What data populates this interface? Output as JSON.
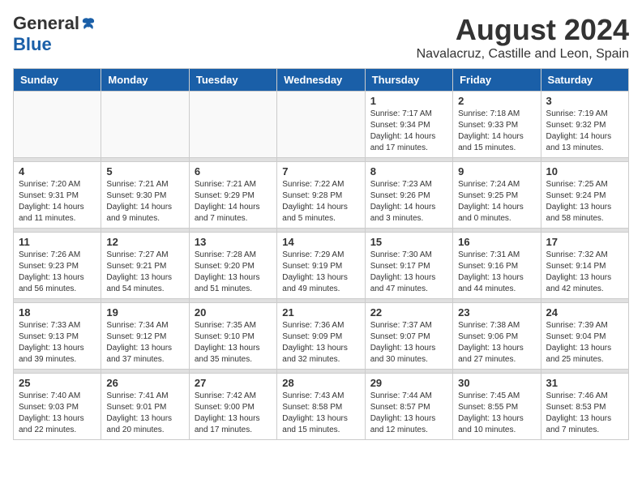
{
  "logo": {
    "general": "General",
    "blue": "Blue"
  },
  "title": "August 2024",
  "location": "Navalacruz, Castille and Leon, Spain",
  "days_header": [
    "Sunday",
    "Monday",
    "Tuesday",
    "Wednesday",
    "Thursday",
    "Friday",
    "Saturday"
  ],
  "weeks": [
    [
      {
        "day": "",
        "info": ""
      },
      {
        "day": "",
        "info": ""
      },
      {
        "day": "",
        "info": ""
      },
      {
        "day": "",
        "info": ""
      },
      {
        "day": "1",
        "info": "Sunrise: 7:17 AM\nSunset: 9:34 PM\nDaylight: 14 hours\nand 17 minutes."
      },
      {
        "day": "2",
        "info": "Sunrise: 7:18 AM\nSunset: 9:33 PM\nDaylight: 14 hours\nand 15 minutes."
      },
      {
        "day": "3",
        "info": "Sunrise: 7:19 AM\nSunset: 9:32 PM\nDaylight: 14 hours\nand 13 minutes."
      }
    ],
    [
      {
        "day": "4",
        "info": "Sunrise: 7:20 AM\nSunset: 9:31 PM\nDaylight: 14 hours\nand 11 minutes."
      },
      {
        "day": "5",
        "info": "Sunrise: 7:21 AM\nSunset: 9:30 PM\nDaylight: 14 hours\nand 9 minutes."
      },
      {
        "day": "6",
        "info": "Sunrise: 7:21 AM\nSunset: 9:29 PM\nDaylight: 14 hours\nand 7 minutes."
      },
      {
        "day": "7",
        "info": "Sunrise: 7:22 AM\nSunset: 9:28 PM\nDaylight: 14 hours\nand 5 minutes."
      },
      {
        "day": "8",
        "info": "Sunrise: 7:23 AM\nSunset: 9:26 PM\nDaylight: 14 hours\nand 3 minutes."
      },
      {
        "day": "9",
        "info": "Sunrise: 7:24 AM\nSunset: 9:25 PM\nDaylight: 14 hours\nand 0 minutes."
      },
      {
        "day": "10",
        "info": "Sunrise: 7:25 AM\nSunset: 9:24 PM\nDaylight: 13 hours\nand 58 minutes."
      }
    ],
    [
      {
        "day": "11",
        "info": "Sunrise: 7:26 AM\nSunset: 9:23 PM\nDaylight: 13 hours\nand 56 minutes."
      },
      {
        "day": "12",
        "info": "Sunrise: 7:27 AM\nSunset: 9:21 PM\nDaylight: 13 hours\nand 54 minutes."
      },
      {
        "day": "13",
        "info": "Sunrise: 7:28 AM\nSunset: 9:20 PM\nDaylight: 13 hours\nand 51 minutes."
      },
      {
        "day": "14",
        "info": "Sunrise: 7:29 AM\nSunset: 9:19 PM\nDaylight: 13 hours\nand 49 minutes."
      },
      {
        "day": "15",
        "info": "Sunrise: 7:30 AM\nSunset: 9:17 PM\nDaylight: 13 hours\nand 47 minutes."
      },
      {
        "day": "16",
        "info": "Sunrise: 7:31 AM\nSunset: 9:16 PM\nDaylight: 13 hours\nand 44 minutes."
      },
      {
        "day": "17",
        "info": "Sunrise: 7:32 AM\nSunset: 9:14 PM\nDaylight: 13 hours\nand 42 minutes."
      }
    ],
    [
      {
        "day": "18",
        "info": "Sunrise: 7:33 AM\nSunset: 9:13 PM\nDaylight: 13 hours\nand 39 minutes."
      },
      {
        "day": "19",
        "info": "Sunrise: 7:34 AM\nSunset: 9:12 PM\nDaylight: 13 hours\nand 37 minutes."
      },
      {
        "day": "20",
        "info": "Sunrise: 7:35 AM\nSunset: 9:10 PM\nDaylight: 13 hours\nand 35 minutes."
      },
      {
        "day": "21",
        "info": "Sunrise: 7:36 AM\nSunset: 9:09 PM\nDaylight: 13 hours\nand 32 minutes."
      },
      {
        "day": "22",
        "info": "Sunrise: 7:37 AM\nSunset: 9:07 PM\nDaylight: 13 hours\nand 30 minutes."
      },
      {
        "day": "23",
        "info": "Sunrise: 7:38 AM\nSunset: 9:06 PM\nDaylight: 13 hours\nand 27 minutes."
      },
      {
        "day": "24",
        "info": "Sunrise: 7:39 AM\nSunset: 9:04 PM\nDaylight: 13 hours\nand 25 minutes."
      }
    ],
    [
      {
        "day": "25",
        "info": "Sunrise: 7:40 AM\nSunset: 9:03 PM\nDaylight: 13 hours\nand 22 minutes."
      },
      {
        "day": "26",
        "info": "Sunrise: 7:41 AM\nSunset: 9:01 PM\nDaylight: 13 hours\nand 20 minutes."
      },
      {
        "day": "27",
        "info": "Sunrise: 7:42 AM\nSunset: 9:00 PM\nDaylight: 13 hours\nand 17 minutes."
      },
      {
        "day": "28",
        "info": "Sunrise: 7:43 AM\nSunset: 8:58 PM\nDaylight: 13 hours\nand 15 minutes."
      },
      {
        "day": "29",
        "info": "Sunrise: 7:44 AM\nSunset: 8:57 PM\nDaylight: 13 hours\nand 12 minutes."
      },
      {
        "day": "30",
        "info": "Sunrise: 7:45 AM\nSunset: 8:55 PM\nDaylight: 13 hours\nand 10 minutes."
      },
      {
        "day": "31",
        "info": "Sunrise: 7:46 AM\nSunset: 8:53 PM\nDaylight: 13 hours\nand 7 minutes."
      }
    ]
  ]
}
